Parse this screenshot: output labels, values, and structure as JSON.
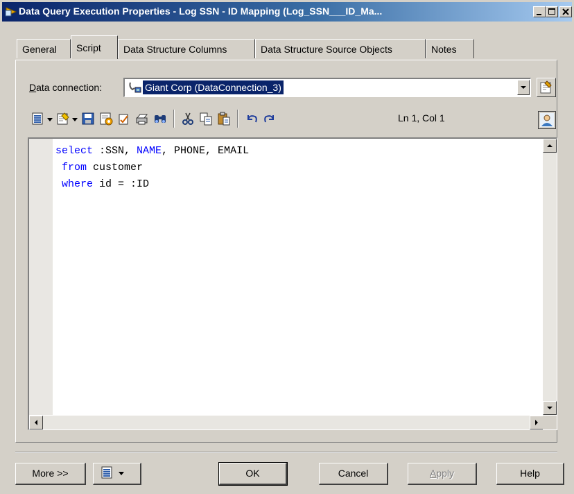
{
  "window": {
    "title": "Data Query Execution Properties - Log SSN - ID Mapping (Log_SSN___ID_Ma...",
    "app_icon": "data-query-execution-icon",
    "controls": [
      "minimize-icon",
      "maximize-icon",
      "close-icon"
    ]
  },
  "tabs": [
    {
      "label": "General",
      "active": false
    },
    {
      "label": "Script",
      "active": true
    },
    {
      "label": "Data Structure Columns",
      "active": false
    },
    {
      "label": "Data Structure Source Objects",
      "active": false
    },
    {
      "label": "Notes",
      "active": false
    }
  ],
  "data_connection": {
    "label_prefix": "D",
    "label_rest": "ata connection:",
    "value": "Giant Corp (DataConnection_3)"
  },
  "toolbar": {
    "icons": [
      "edit-menu-icon",
      "insert-icon",
      "save-icon",
      "run-icon",
      "check-icon",
      "print-icon",
      "find-icon",
      "cut-icon",
      "copy-icon",
      "paste-icon",
      "undo-icon",
      "redo-icon"
    ],
    "position": "Ln 1, Col 1"
  },
  "editor": {
    "lines": [
      {
        "kw": "select",
        "rest": " :SSN, ",
        "kw2": "NAME",
        "rest2": ", PHONE, EMAIL"
      },
      {
        "kw": " from",
        "rest": " customer"
      },
      {
        "kw": " where",
        "rest": " id = :ID"
      }
    ]
  },
  "buttons": {
    "more": "More >>",
    "ok": "OK",
    "cancel": "Cancel",
    "apply_prefix": "A",
    "apply_rest": "pply",
    "help": "Help"
  },
  "colors": {
    "title_bar": "#0a246a",
    "keyword": "#0000ff",
    "face": "#d4d0c8",
    "selection": "#0a246a"
  }
}
